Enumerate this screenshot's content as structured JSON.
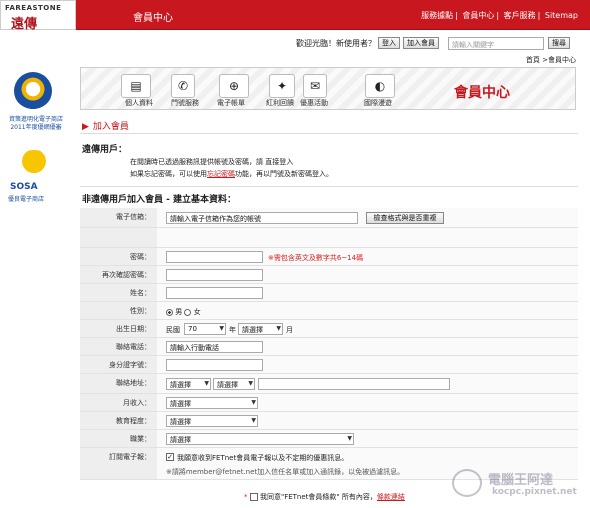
{
  "header": {
    "logo_top": "FAREASTONE",
    "logo_main": "遠傳",
    "section": "會員中心",
    "links": [
      "服務據點",
      "會員中心",
      "客戶服務",
      "Sitemap"
    ]
  },
  "account": {
    "welcome": "歡迎光臨！新使用者？",
    "login": "登入",
    "join": "加入會員",
    "search_placeholder": "請輸入關鍵字",
    "search_btn": "搜尋"
  },
  "breadcrumb": "首頁 >會員中心",
  "side": {
    "badge1": "資策進明化電子商店\n2011年度優網優審",
    "badge2": "SOSA",
    "badge2_sub": "優良電子商店"
  },
  "nav": {
    "items": [
      "個人資料",
      "門號服務",
      "電子帳單",
      "紅利回饋",
      "優惠活動",
      "國際漫遊"
    ],
    "title": "會員中心"
  },
  "page": {
    "add_member": "加入會員",
    "fet_user": "遠傳用戶：",
    "intro1": "在閱讀時已透過服務訊提供帳號及密碼，請 直接登入",
    "intro2a": "如果忘記密碼，可以使用",
    "intro2link": "忘記密碼",
    "intro2b": "功能，再以門號及新密碼登入。",
    "reg_title": "非遠傳用戶加入會員 - 建立基本資料："
  },
  "form": {
    "email_label": "電子信箱：",
    "email_value": "請輸入電子信箱作為您的帳號",
    "check_btn": "檢查格式與是否重複",
    "pwd_label": "密碼：",
    "pwd_hint": "※需包含英文及數字共6~14碼",
    "pwd2_label": "再次確認密碼：",
    "name_label": "姓名：",
    "gender_label": "性別：",
    "male": "男",
    "female": "女",
    "birth_label": "出生日期：",
    "era": "民國",
    "year": "70",
    "year_unit": "年",
    "month": "請選擇",
    "month_unit": "月",
    "phone_label": "聯絡電話：",
    "phone_value": "請輸入行動電話",
    "id_label": "身分證字號：",
    "addr_label": "聯絡地址：",
    "city": "請選擇",
    "district": "請選擇",
    "income_label": "月收入：",
    "income": "請選擇",
    "edu_label": "教育程度：",
    "edu": "請選擇",
    "job_label": "職業：",
    "job": "請選擇",
    "sub_label": "訂閱電子報：",
    "sub_text": "我願意收到FETnet會員電子報以及不定期的優惠訊息。",
    "sub_note": "※請將member@fetnet.net加入信任名單或加入通訊錄，以免被過濾訊息。"
  },
  "terms": {
    "a": "* ",
    "b": "我同意\"FETnet會員條款\" 所有內容，",
    "link": "條款連結"
  },
  "watermark": {
    "line1": "電腦王阿達",
    "line2": "kocpc.pixnet.net"
  }
}
